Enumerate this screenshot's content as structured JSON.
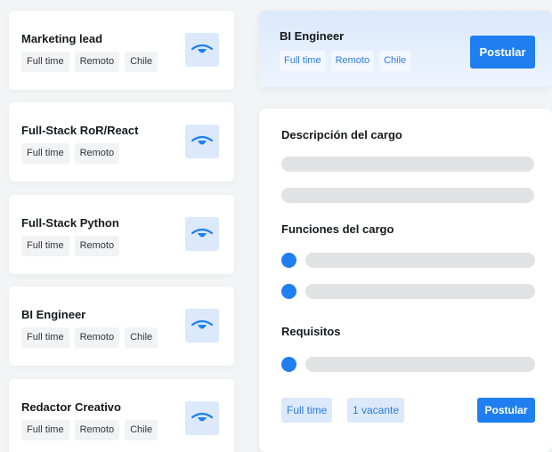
{
  "job_list": [
    {
      "title": "Marketing lead",
      "tags": [
        "Full time",
        "Remoto",
        "Chile"
      ]
    },
    {
      "title": "Full-Stack RoR/React",
      "tags": [
        "Full time",
        "Remoto"
      ]
    },
    {
      "title": "Full-Stack Python",
      "tags": [
        "Full time",
        "Remoto"
      ]
    },
    {
      "title": "BI Engineer",
      "tags": [
        "Full time",
        "Remoto",
        "Chile"
      ]
    },
    {
      "title": "Redactor Creativo",
      "tags": [
        "Full time",
        "Remoto",
        "Chile"
      ]
    }
  ],
  "selected_job": {
    "title": "BI Engineer",
    "tags": [
      "Full time",
      "Remoto",
      "Chile"
    ],
    "apply_label": "Postular"
  },
  "description": {
    "section_description": "Descripción del cargo",
    "section_functions": "Funciones del cargo",
    "section_requirements": "Requisitos",
    "footer_tags": [
      "Full time",
      "1 vacante"
    ],
    "apply_label": "Postular"
  },
  "icons": {
    "view": "eye-icon",
    "bullet": "bullet-dot"
  },
  "colors": {
    "accent": "#1f7ff0",
    "accent_light": "#dbe9fb",
    "skeleton": "#e1e2e4"
  }
}
